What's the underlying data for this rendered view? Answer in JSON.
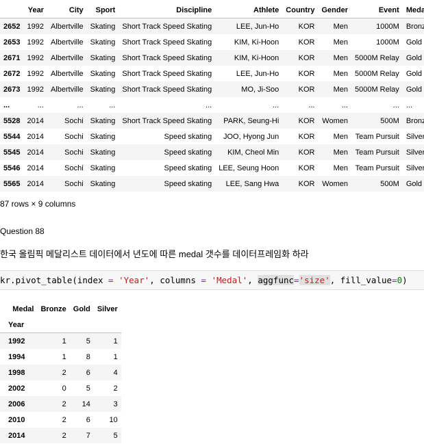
{
  "table1": {
    "columns": [
      "",
      "Year",
      "City",
      "Sport",
      "Discipline",
      "Athlete",
      "Country",
      "Gender",
      "Event",
      "Medal"
    ],
    "rows": [
      [
        "2652",
        "1992",
        "Albertville",
        "Skating",
        "Short Track Speed Skating",
        "LEE, Jun-Ho",
        "KOR",
        "Men",
        "1000M",
        "Bronze"
      ],
      [
        "2653",
        "1992",
        "Albertville",
        "Skating",
        "Short Track Speed Skating",
        "KIM, Ki-Hoon",
        "KOR",
        "Men",
        "1000M",
        "Gold"
      ],
      [
        "2671",
        "1992",
        "Albertville",
        "Skating",
        "Short Track Speed Skating",
        "KIM, Ki-Hoon",
        "KOR",
        "Men",
        "5000M Relay",
        "Gold"
      ],
      [
        "2672",
        "1992",
        "Albertville",
        "Skating",
        "Short Track Speed Skating",
        "LEE, Jun-Ho",
        "KOR",
        "Men",
        "5000M Relay",
        "Gold"
      ],
      [
        "2673",
        "1992",
        "Albertville",
        "Skating",
        "Short Track Speed Skating",
        "MO, Ji-Soo",
        "KOR",
        "Men",
        "5000M Relay",
        "Gold"
      ],
      [
        "...",
        "...",
        "...",
        "...",
        "...",
        "...",
        "...",
        "...",
        "...",
        "..."
      ],
      [
        "5528",
        "2014",
        "Sochi",
        "Skating",
        "Short Track Speed Skating",
        "PARK, Seung-Hi",
        "KOR",
        "Women",
        "500M",
        "Bronze"
      ],
      [
        "5544",
        "2014",
        "Sochi",
        "Skating",
        "Speed skating",
        "JOO, Hyong Jun",
        "KOR",
        "Men",
        "Team Pursuit",
        "Silver"
      ],
      [
        "5545",
        "2014",
        "Sochi",
        "Skating",
        "Speed skating",
        "KIM, Cheol Min",
        "KOR",
        "Men",
        "Team Pursuit",
        "Silver"
      ],
      [
        "5546",
        "2014",
        "Sochi",
        "Skating",
        "Speed skating",
        "LEE, Seung Hoon",
        "KOR",
        "Men",
        "Team Pursuit",
        "Silver"
      ],
      [
        "5565",
        "2014",
        "Sochi",
        "Skating",
        "Speed skating",
        "LEE, Sang Hwa",
        "KOR",
        "Women",
        "500M",
        "Gold"
      ]
    ]
  },
  "shape_text": "87 rows × 9 columns",
  "question_title": "Question 88",
  "question_text": "한국 올림픽 메달리스트 데이터에서 년도에 따른 medal 갯수를 데이터프레임화 하라",
  "code": {
    "t1": "kr.pivot_table(index ",
    "t2": "=",
    "t3": " ",
    "t4": "'Year'",
    "t5": ", columns ",
    "t6": "=",
    "t7": " ",
    "t8": "'Medal'",
    "t9": ", ",
    "t10": "aggfunc",
    "t11": "=",
    "t12": "'size'",
    "t13": ", fill_value",
    "t14": "=",
    "t15": "0",
    "t16": ")"
  },
  "table2": {
    "col_header_name": "Medal",
    "columns": [
      "Bronze",
      "Gold",
      "Silver"
    ],
    "index_name": "Year",
    "rows": [
      [
        "1992",
        "1",
        "5",
        "1"
      ],
      [
        "1994",
        "1",
        "8",
        "1"
      ],
      [
        "1998",
        "2",
        "6",
        "4"
      ],
      [
        "2002",
        "0",
        "5",
        "2"
      ],
      [
        "2006",
        "2",
        "14",
        "3"
      ],
      [
        "2010",
        "2",
        "6",
        "10"
      ],
      [
        "2014",
        "2",
        "7",
        "5"
      ]
    ]
  }
}
